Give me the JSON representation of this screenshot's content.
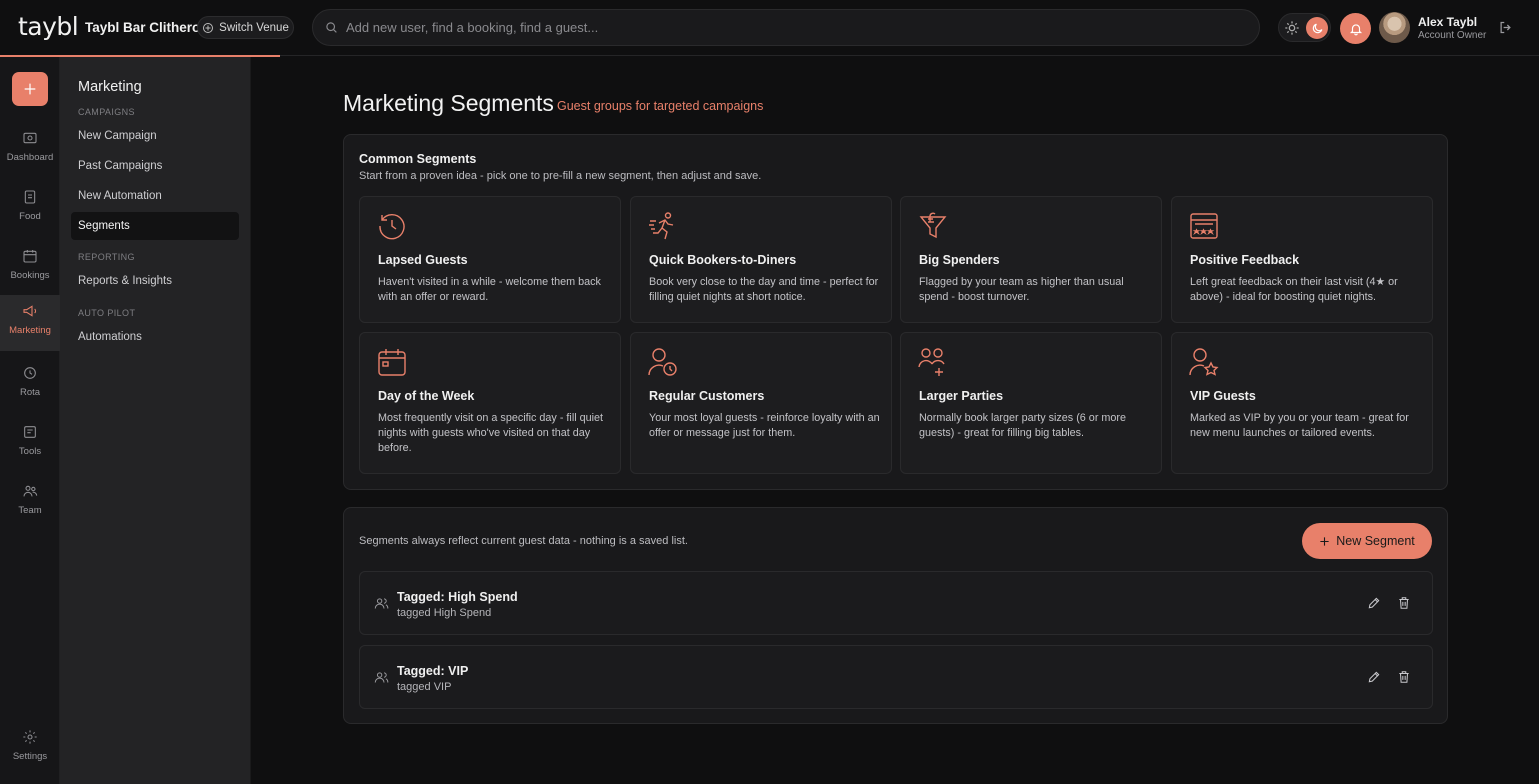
{
  "brand": {
    "logo": "taybl",
    "accent": "#e8806a"
  },
  "topbar": {
    "venue_name": "Taybl Bar Clitheroe",
    "switch_venue_label": "Switch Venue",
    "search_placeholder": "Add new user, find a booking, find a guest...",
    "user": {
      "name": "Alex Taybl",
      "role": "Account Owner"
    }
  },
  "rail": {
    "items": [
      {
        "label": "Dashboard",
        "icon": "dashboard-icon"
      },
      {
        "label": "Food",
        "icon": "food-icon"
      },
      {
        "label": "Bookings",
        "icon": "bookings-icon"
      },
      {
        "label": "Marketing",
        "icon": "megaphone-icon",
        "active": true
      },
      {
        "label": "Rota",
        "icon": "rota-icon"
      },
      {
        "label": "Tools",
        "icon": "tools-icon"
      },
      {
        "label": "Team",
        "icon": "team-icon"
      }
    ],
    "settings_label": "Settings"
  },
  "subnav": {
    "title": "Marketing",
    "sections": {
      "campaigns": "CAMPAIGNS",
      "reporting": "REPORTING",
      "auto_pilot": "AUTO PILOT"
    },
    "items": {
      "new_campaign": "New Campaign",
      "past_campaigns": "Past Campaigns",
      "new_automation": "New Automation",
      "segments": "Segments",
      "reports": "Reports & Insights",
      "automations": "Automations"
    }
  },
  "main": {
    "title": "Marketing Segments",
    "subtitle": "Guest groups for targeted campaigns",
    "common": {
      "heading": "Common Segments",
      "description": "Start from a proven idea - pick one to pre-fill a new segment, then adjust and save.",
      "cards": [
        {
          "title": "Lapsed Guests",
          "description": "Haven't visited in a while - welcome them back with an offer or reward.",
          "icon": "history-clock-icon"
        },
        {
          "title": "Quick Bookers-to-Diners",
          "description": "Book very close to the day and time - perfect for filling quiet nights at short notice.",
          "icon": "running-person-icon"
        },
        {
          "title": "Big Spenders",
          "description": "Flagged by your team as higher than usual spend - boost turnover.",
          "icon": "money-funnel-icon"
        },
        {
          "title": "Positive Feedback",
          "description": "Left great feedback on their last visit (4★ or above) - ideal for boosting quiet nights.",
          "icon": "rating-stars-icon"
        },
        {
          "title": "Day of the Week",
          "description": "Most frequently visit on a specific day - fill quiet nights with guests who've visited on that day before.",
          "icon": "calendar-icon"
        },
        {
          "title": "Regular Customers",
          "description": "Your most loyal guests - reinforce loyalty with an offer or message just for them.",
          "icon": "user-clock-icon"
        },
        {
          "title": "Larger Parties",
          "description": "Normally book larger party sizes (6 or more guests) - great for filling big tables.",
          "icon": "group-add-icon"
        },
        {
          "title": "VIP Guests",
          "description": "Marked as VIP by you or your team - great for new menu launches or tailored events.",
          "icon": "user-star-icon"
        }
      ]
    },
    "list": {
      "note": "Segments always reflect current guest data - nothing is a saved list.",
      "new_segment_label": "New Segment",
      "segments": [
        {
          "title": "Tagged: High Spend",
          "subtitle": "tagged High Spend"
        },
        {
          "title": "Tagged: VIP",
          "subtitle": "tagged VIP"
        }
      ]
    }
  }
}
